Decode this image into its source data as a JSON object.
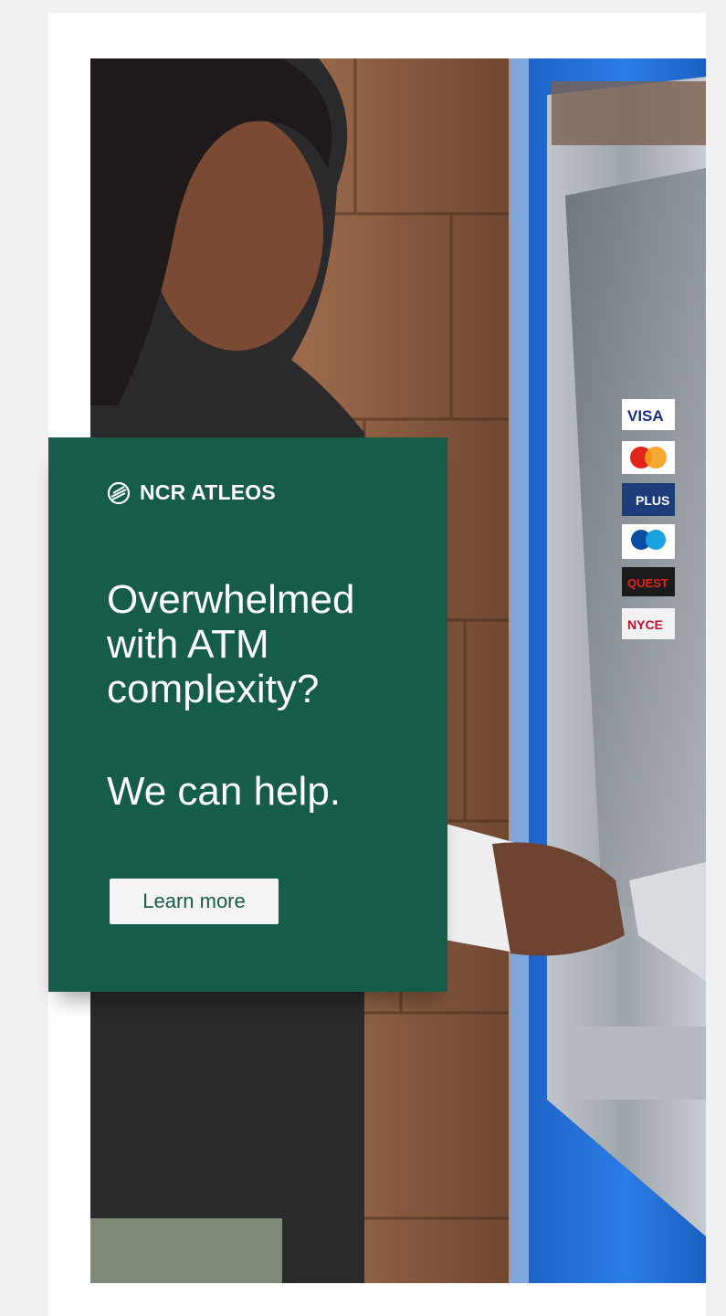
{
  "ad": {
    "brand": "NCR ATLEOS",
    "headline_lines": [
      "Overwhelmed",
      "with ATM",
      "complexity?"
    ],
    "subhead": "We can help.",
    "cta_label": "Learn more"
  },
  "photo": {
    "card_logos": [
      "VISA",
      "mastercard",
      "PLUS",
      "maestro",
      "QUEST",
      "NYCE"
    ]
  },
  "colors": {
    "panel": "#155c4a",
    "button_bg": "#f4f4f2",
    "page_bg": "#f1f1f1",
    "atm_blue": "#1f6fd6"
  }
}
